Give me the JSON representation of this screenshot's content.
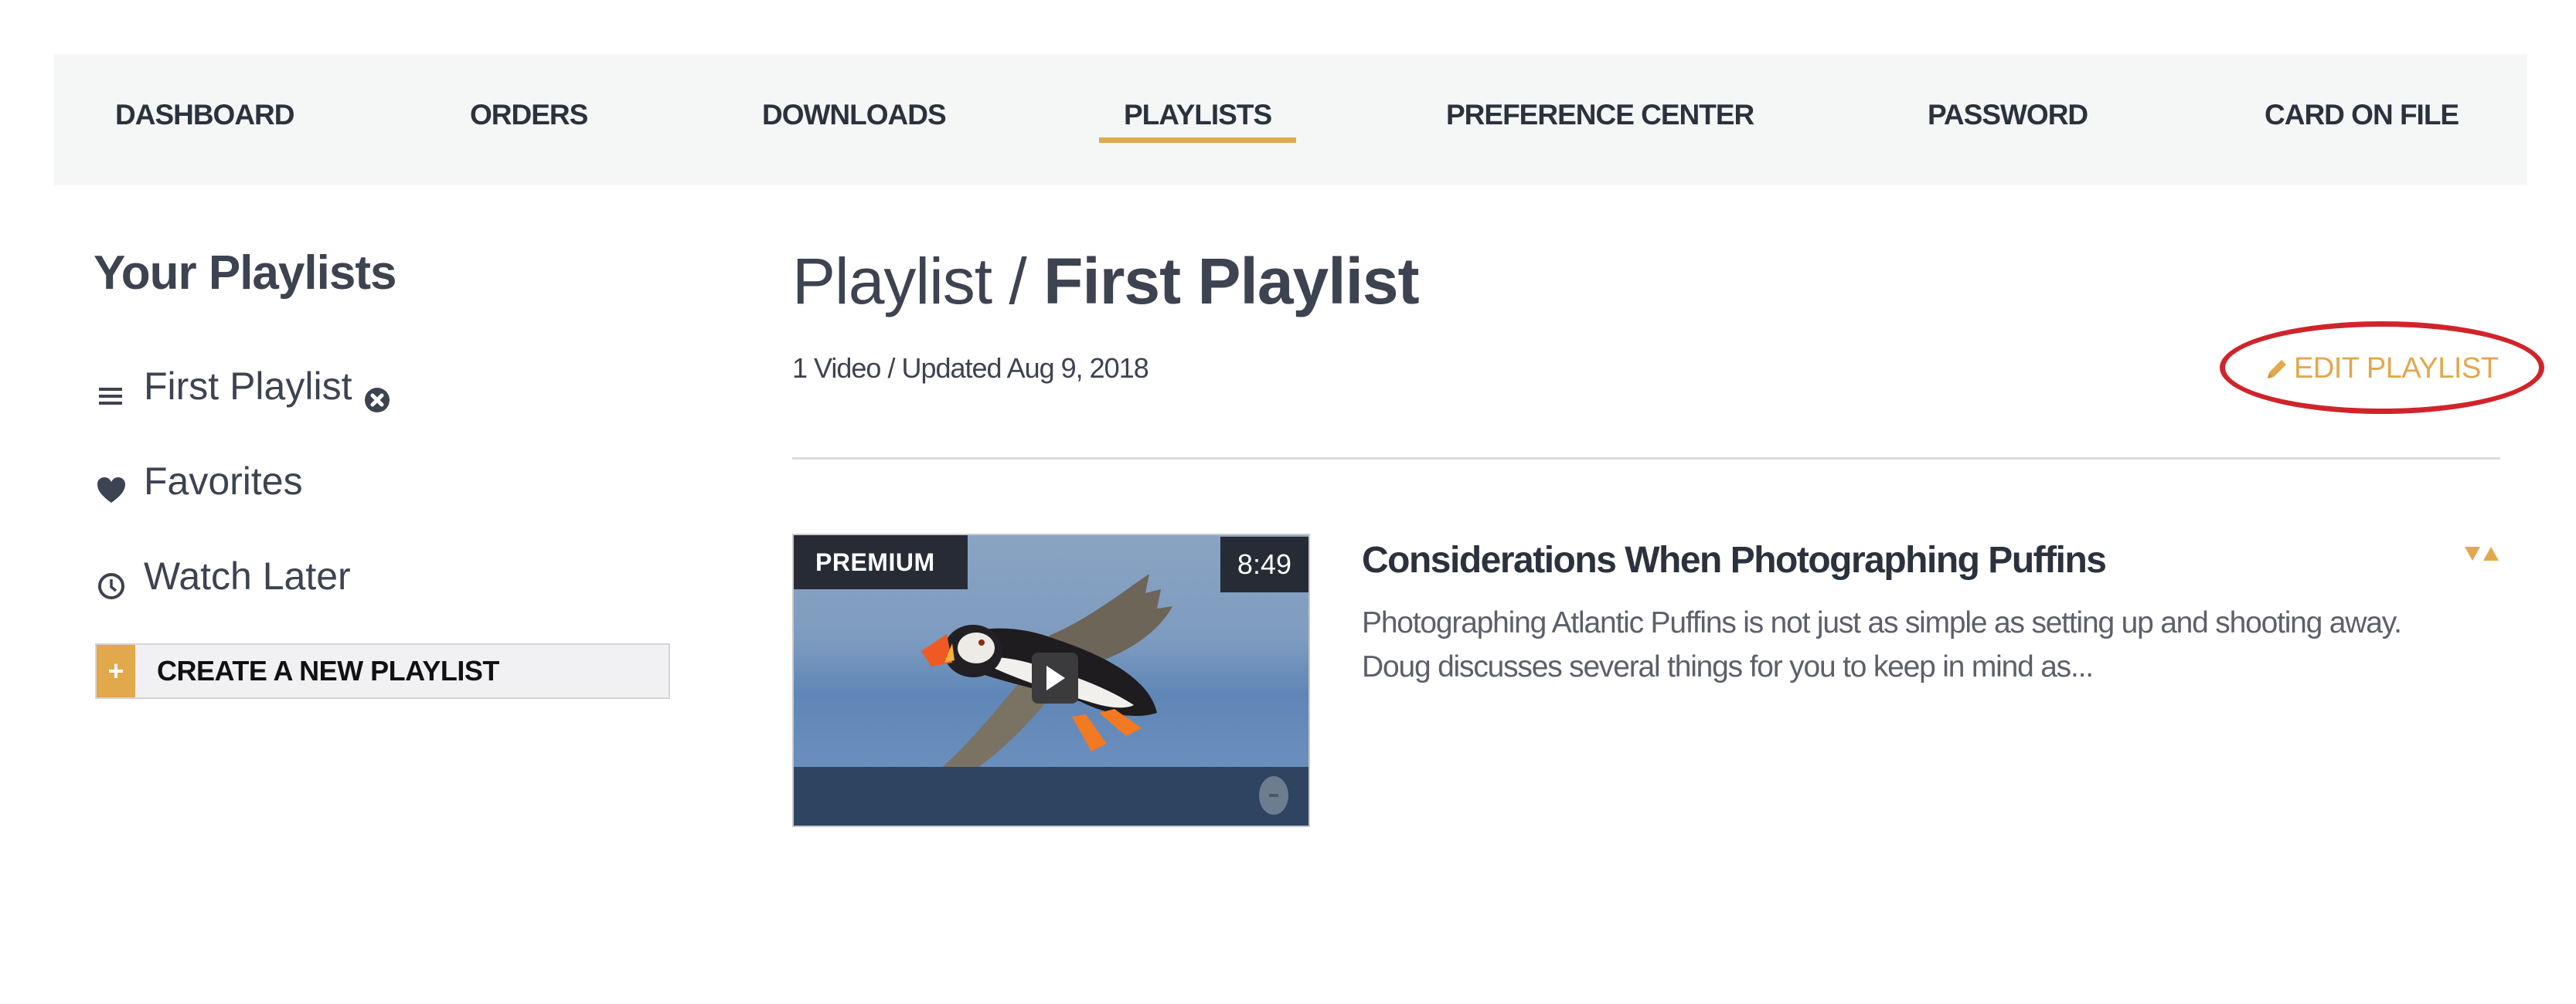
{
  "nav": {
    "items": [
      {
        "label": "DASHBOARD",
        "active": false
      },
      {
        "label": "ORDERS",
        "active": false
      },
      {
        "label": "DOWNLOADS",
        "active": false
      },
      {
        "label": "PLAYLISTS",
        "active": true
      },
      {
        "label": "PREFERENCE CENTER",
        "active": false
      },
      {
        "label": "PASSWORD",
        "active": false
      },
      {
        "label": "CARD ON FILE",
        "active": false
      }
    ],
    "active_color": "#e2a84c"
  },
  "sidebar": {
    "title": "Your Playlists",
    "items": [
      {
        "label": "First Playlist",
        "icon": "hamburger-icon",
        "trailing_icon": "remove-circle-icon"
      },
      {
        "label": "Favorites",
        "icon": "heart-icon"
      },
      {
        "label": "Watch Later",
        "icon": "clock-icon"
      }
    ],
    "create_button": {
      "icon": "+",
      "label": "CREATE A NEW PLAYLIST"
    }
  },
  "main": {
    "title_prefix": "Playlist / ",
    "title_name": "First Playlist",
    "meta": "1 Video / Updated Aug 9, 2018",
    "edit_button": {
      "icon": "pencil-icon",
      "label": "EDIT PLAYLIST"
    },
    "accent_color": "#e2a84c",
    "annotation_color": "#d0242b",
    "videos": [
      {
        "badge": "PREMIUM",
        "duration": "8:49",
        "title": "Considerations When Photographing Puffins",
        "description": "Photographing Atlantic Puffins is not just as simple as setting up and shooting away. Doug discusses several things for you to keep in mind as...",
        "thumbnail_subject": "puffin in flight"
      }
    ]
  }
}
